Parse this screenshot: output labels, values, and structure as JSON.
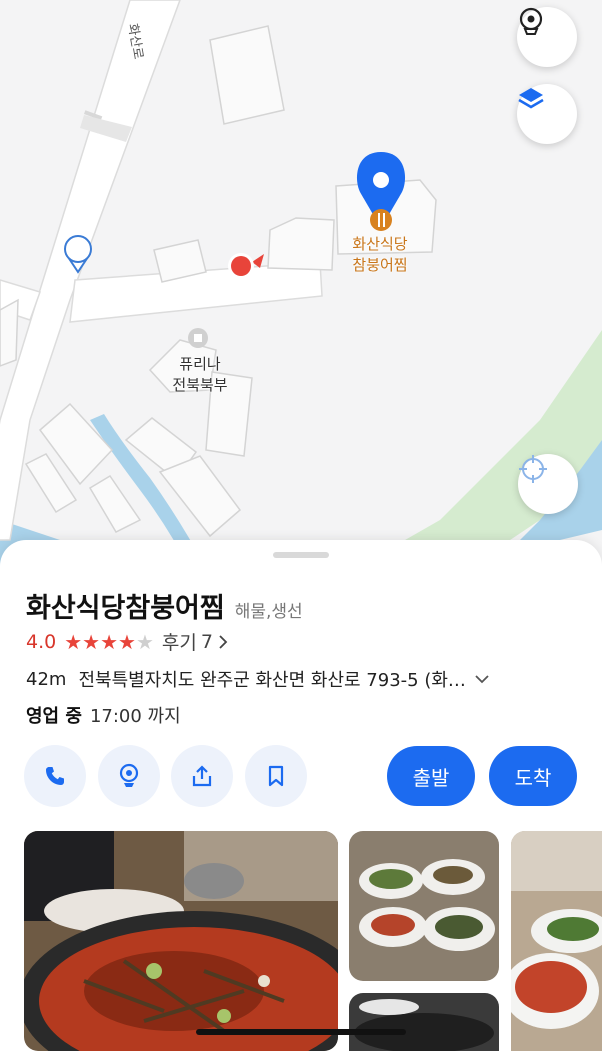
{
  "map": {
    "road_label": "화산로",
    "building_label": "퓨리나\n전북북부",
    "poi_label": "화산식당\n참붕어찜",
    "parking_label": "P"
  },
  "map_buttons": {
    "street_view_icon": "street-view-icon",
    "layers_icon": "layers-icon",
    "locate_icon": "crosshair-icon"
  },
  "place": {
    "name": "화산식당참붕어찜",
    "category": "해물,생선",
    "rating": "4.0",
    "stars_filled": 4,
    "stars_total": 5,
    "reviews_label": "후기",
    "reviews_count": "7",
    "distance": "42m",
    "address": "전북특별자치도 완주군 화산면 화산로 793-5 (화…",
    "status": "영업 중",
    "hours": "17:00 까지"
  },
  "actions": {
    "call_icon": "phone-icon",
    "map_icon": "map-pin-icon",
    "share_icon": "share-icon",
    "save_icon": "bookmark-icon",
    "depart_label": "출발",
    "arrive_label": "도착"
  },
  "colors": {
    "accent": "#1c6bf0",
    "rating": "#d8362b",
    "star": "#e8443a",
    "poi": "#c9761a",
    "water": "#a9d2ea",
    "park": "#d5ebcf"
  }
}
